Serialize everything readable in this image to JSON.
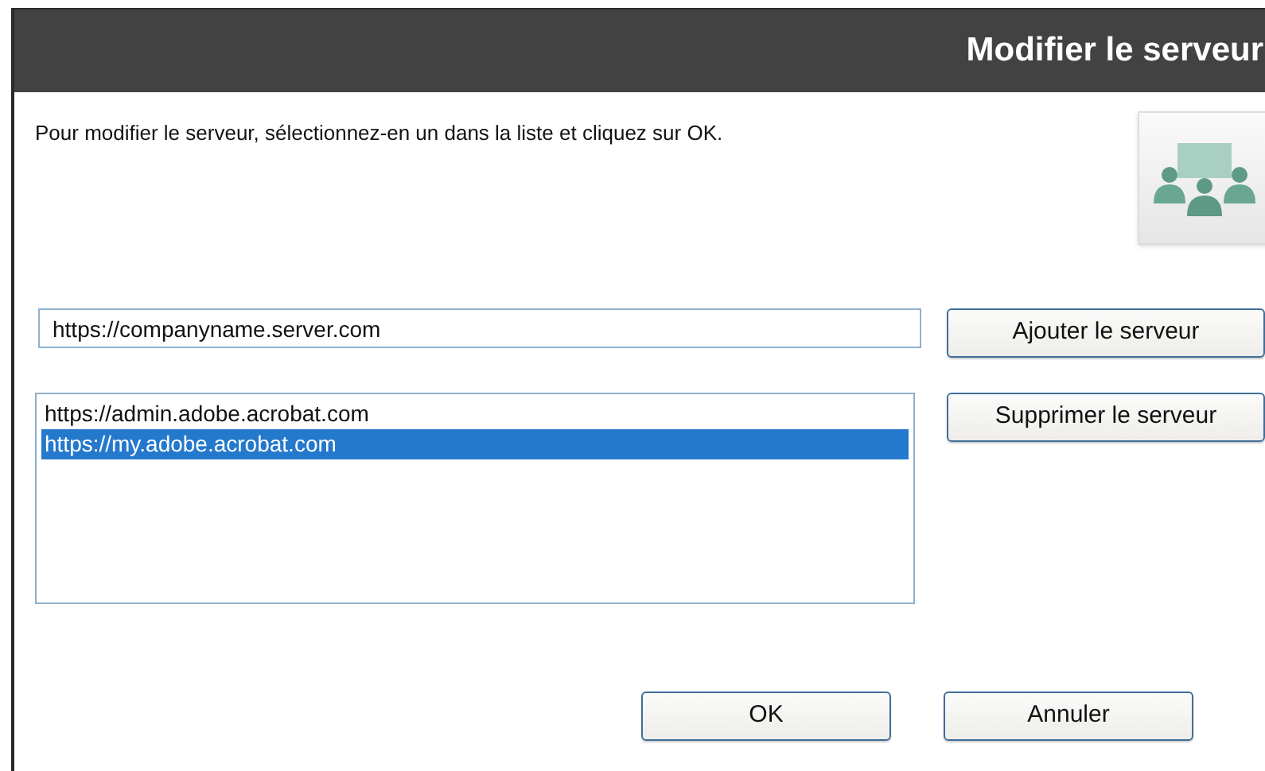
{
  "window": {
    "title": "Modifier le serveur"
  },
  "instruction": "Pour modifier le serveur, sélectionnez-en un dans la liste et cliquez sur OK.",
  "server_field": {
    "value": "https://companyname.server.com"
  },
  "add_button": "Ajouter le serveur",
  "server_list": [
    {
      "label": "https://admin.adobe.acrobat.com",
      "selected": false
    },
    {
      "label": "https://my.adobe.acrobat.com",
      "selected": true
    }
  ],
  "remove_button": "Supprimer le serveur",
  "buttons": [
    "OK",
    "Annuler"
  ]
}
